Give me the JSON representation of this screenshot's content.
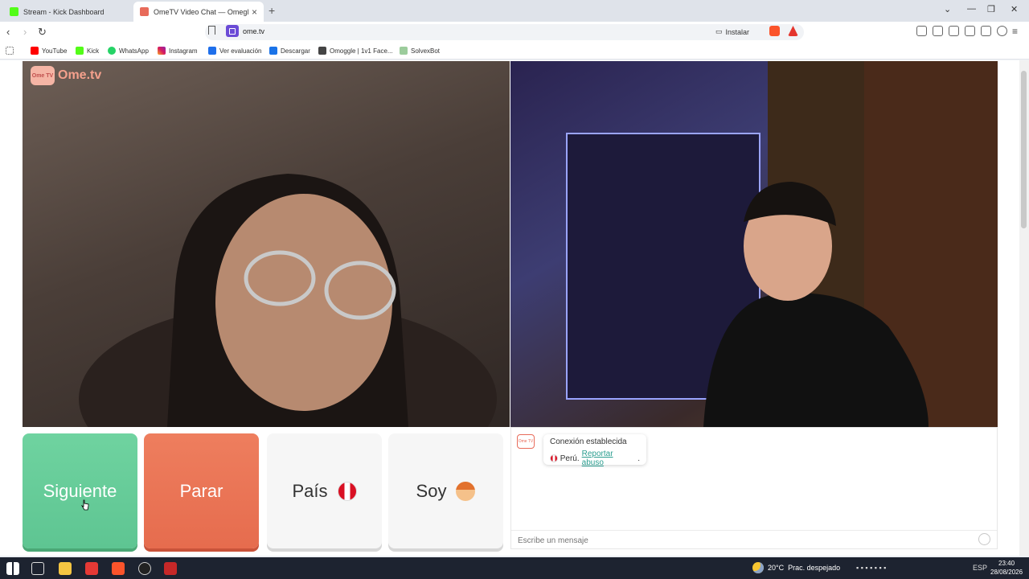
{
  "browser": {
    "tabs": [
      {
        "title": "Stream - Kick Dashboard",
        "active": false
      },
      {
        "title": "OmeTV Video Chat — Omegl",
        "active": true
      }
    ],
    "url": "ome.tv",
    "install_label": "Instalar",
    "bookmarks": [
      "YouTube",
      "Kick",
      "WhatsApp",
      "Instagram",
      "Ver evaluación",
      "Descargar",
      "Omoggle | 1v1 Face...",
      "SolvexBot"
    ]
  },
  "page": {
    "logo_badge": "Ome TV",
    "logo_text": "Ome.tv",
    "buttons": {
      "next": "Siguiente",
      "stop": "Parar",
      "country": "País",
      "gender": "Soy"
    },
    "chat": {
      "badge": "Ome TV",
      "status": "Conexión establecida",
      "country": "Perú.",
      "report": "Reportar abuso",
      "report_suffix": ".",
      "input_placeholder": "Escribe un mensaje"
    }
  },
  "taskbar": {
    "temperature": "20°C",
    "weather": "Prac. despejado",
    "language": "ESP",
    "time": "23:40",
    "date": "28/08/2026"
  },
  "colors": {
    "next": "#5ec592",
    "stop": "#e66c4e",
    "brand": "#f4a08c",
    "link": "#2a9d8f"
  }
}
